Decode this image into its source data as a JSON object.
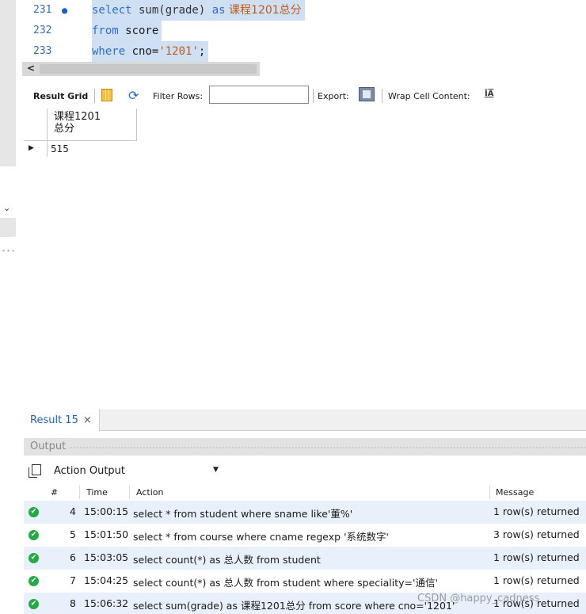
{
  "editor": {
    "lines": [
      {
        "num": "231",
        "has_dot": true,
        "kw1": "select",
        "fn": " sum(grade) ",
        "kw2": "as",
        "alias": " 课程1201总分"
      },
      {
        "num": "232",
        "has_dot": false,
        "kw1": "from",
        "rest": " score"
      },
      {
        "num": "233",
        "has_dot": false,
        "kw1": "where",
        "rest": " cno=",
        "str": "'1201'",
        "end": ";"
      }
    ],
    "dot": "●",
    "scroll_left": "<"
  },
  "toolbar": {
    "result_grid_label": "Result Grid",
    "filter_label": "Filter Rows:",
    "filter_value": "",
    "export_label": "Export:",
    "wrap_label": "Wrap Cell Content:",
    "wrap_icon": "ĪA"
  },
  "grid": {
    "column_header": "课程1201\n总分",
    "row_marker": "▶",
    "value": "515"
  },
  "result_tab": {
    "label": "Result 15",
    "close": "×"
  },
  "output": {
    "title": "Output",
    "selector_value": "Action Output",
    "columns": [
      "#",
      "Time",
      "Action",
      "Message"
    ],
    "rows": [
      {
        "num": "4",
        "time": "15:00:15",
        "action": "select * from student where sname like'董%'",
        "message": "1 row(s) returned"
      },
      {
        "num": "5",
        "time": "15:01:50",
        "action": "select * from course where cname regexp '系统数字'",
        "message": "3 row(s) returned"
      },
      {
        "num": "6",
        "time": "15:03:05",
        "action": "select count(*) as 总人数 from student",
        "message": "1 row(s) returned"
      },
      {
        "num": "7",
        "time": "15:04:25",
        "action": "select count(*) as 总人数 from student where speciality='通信'",
        "message": "1 row(s) returned"
      },
      {
        "num": "8",
        "time": "15:06:32",
        "action": "select sum(grade) as 课程1201总分 from score where cno='1201'",
        "message": "1 row(s) returned"
      }
    ]
  },
  "watermark": "CSDN @happy_cadness",
  "colors": {
    "keyword": "#2f6fc0",
    "selection": "#cfe0f5",
    "ok_green": "#27a847",
    "tab_blue": "#2563a8"
  }
}
